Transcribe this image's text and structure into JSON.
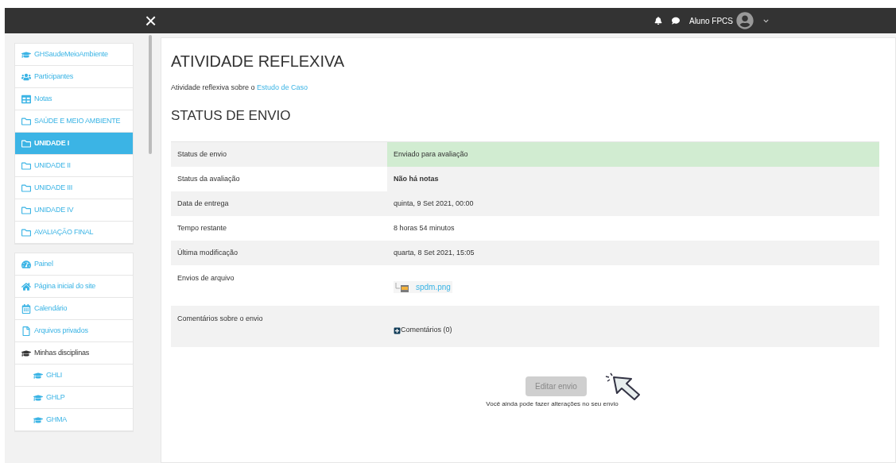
{
  "topbar": {
    "close": "×",
    "user": "Aluno FPCS"
  },
  "sidebar": {
    "groups": [
      {
        "items": [
          {
            "label": "GHSaudeMeioAmbiente",
            "kind": "course",
            "selected": false
          },
          {
            "label": "Participantes",
            "kind": "people",
            "selected": false
          },
          {
            "label": "Notas",
            "kind": "grades",
            "selected": false
          },
          {
            "label": "SAÚDE E MEIO AMBIENTE",
            "kind": "section",
            "selected": false
          },
          {
            "label": "UNIDADE I",
            "kind": "section",
            "selected": true
          },
          {
            "label": "UNIDADE II",
            "kind": "section",
            "selected": false
          },
          {
            "label": "UNIDADE III",
            "kind": "section",
            "selected": false
          },
          {
            "label": "UNIDADE IV",
            "kind": "section",
            "selected": false
          },
          {
            "label": "AVALIAÇÃO FINAL",
            "kind": "section",
            "selected": false
          }
        ]
      },
      {
        "items": [
          {
            "label": "Painel",
            "kind": "dashboard",
            "selected": false
          },
          {
            "label": "Página inicial do site",
            "kind": "home",
            "selected": false
          },
          {
            "label": "Calendário",
            "kind": "calendar",
            "selected": false
          },
          {
            "label": "Arquivos privados",
            "kind": "files",
            "selected": false
          },
          {
            "label": "Minhas disciplinas",
            "kind": "heading",
            "selected": false,
            "children": [
              {
                "label": "GHLI",
                "kind": "course",
                "selected": false
              },
              {
                "label": "GHLP",
                "kind": "course",
                "selected": false
              },
              {
                "label": "GHMA",
                "kind": "course",
                "selected": false
              }
            ]
          }
        ]
      }
    ]
  },
  "main": {
    "title": "ATIVIDADE REFLEXIVA",
    "intro": "Atividade reflexiva sobre o ",
    "intro_link": "Estudo de Caso",
    "section": "STATUS DE ENVIO",
    "rows": [
      {
        "label": "Status de envio",
        "value": "Enviado para avaliação",
        "kind": "text",
        "highlighted": true,
        "bold": false
      },
      {
        "label": "Status da avaliação",
        "value": "Não há notas",
        "kind": "text",
        "highlighted": false,
        "bold": true
      },
      {
        "label": "Data de entrega",
        "value": "quinta, 9 Set 2021, 00:00",
        "kind": "text",
        "highlighted": false,
        "bold": false
      },
      {
        "label": "Tempo restante",
        "value": "8 horas 54 minutos",
        "kind": "text",
        "highlighted": false,
        "bold": false
      },
      {
        "label": "Última modificação",
        "value": "quarta, 8 Set 2021, 15:05",
        "kind": "text",
        "highlighted": false,
        "bold": false
      },
      {
        "label": "Envios de arquivo",
        "value": "spdm.png",
        "kind": "file",
        "highlighted": false,
        "bold": false
      },
      {
        "label": "Comentários sobre o envio",
        "value": "Comentários (0)",
        "kind": "comments",
        "highlighted": false,
        "bold": false
      }
    ],
    "button": {
      "label": "Editar envio",
      "disabled": true
    },
    "note": "Você ainda pode fazer alterações no seu envio"
  }
}
